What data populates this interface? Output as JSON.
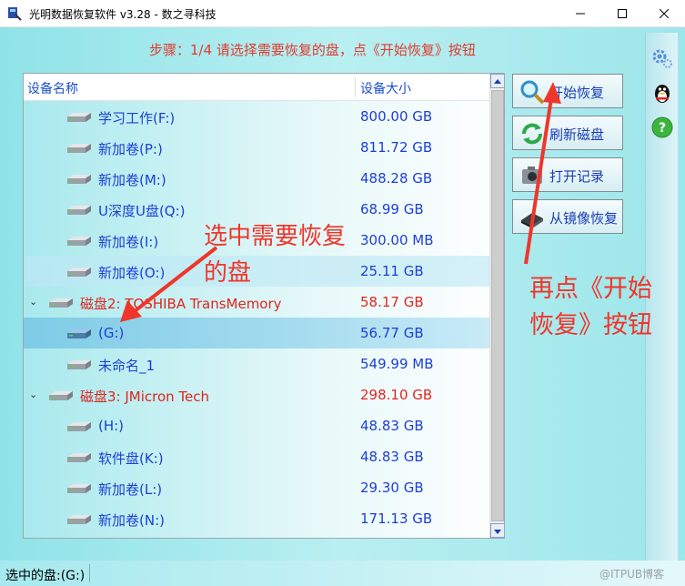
{
  "window": {
    "title": "光明数据恢复软件 v3.28  -  数之寻科技"
  },
  "step": {
    "text": "步骤：1/4 请选择需要恢复的盘，点《开始恢复》按钮"
  },
  "list": {
    "col_name": "设备名称",
    "col_size": "设备大小",
    "rows": [
      {
        "kind": "vol",
        "name": "学习工作(F:)",
        "size": "800.00 GB"
      },
      {
        "kind": "vol",
        "name": "新加卷(P:)",
        "size": "811.72 GB"
      },
      {
        "kind": "vol",
        "name": "新加卷(M:)",
        "size": "488.28 GB"
      },
      {
        "kind": "vol",
        "name": "U深度U盘(Q:)",
        "size": "68.99 GB"
      },
      {
        "kind": "vol",
        "name": "新加卷(I:)",
        "size": "300.00 MB"
      },
      {
        "kind": "vol",
        "name": "新加卷(O:)",
        "size": "25.11 GB"
      },
      {
        "kind": "grp",
        "name": "磁盘2: TOSHIBA  TransMemory",
        "size": "58.17 GB"
      },
      {
        "kind": "vol",
        "name": "(G:)",
        "size": "56.77 GB"
      },
      {
        "kind": "vol",
        "name": "未命名_1",
        "size": "549.99 MB"
      },
      {
        "kind": "grp",
        "name": "磁盘3: JMicron  Tech",
        "size": "298.10 GB"
      },
      {
        "kind": "vol",
        "name": "(H:)",
        "size": "48.83 GB"
      },
      {
        "kind": "vol",
        "name": "软件盘(K:)",
        "size": "48.83 GB"
      },
      {
        "kind": "vol",
        "name": "新加卷(L:)",
        "size": "29.30 GB"
      },
      {
        "kind": "vol",
        "name": "新加卷(N:)",
        "size": "171.13 GB"
      }
    ]
  },
  "buttons": {
    "start": "开始恢复",
    "refresh": "刷新磁盘",
    "open_record": "打开记录",
    "from_image": "从镜像恢复"
  },
  "annotations": {
    "note1_line1": "选中需要恢复",
    "note1_line2": "的盘",
    "note2_line1": "再点《开始",
    "note2_line2": "恢复》按钮"
  },
  "status": {
    "text": "选中的盘:(G:)",
    "watermark": "@ITPUB博客"
  },
  "colors": {
    "accent_red": "#e0261f",
    "link_blue": "#1c3fd6"
  }
}
